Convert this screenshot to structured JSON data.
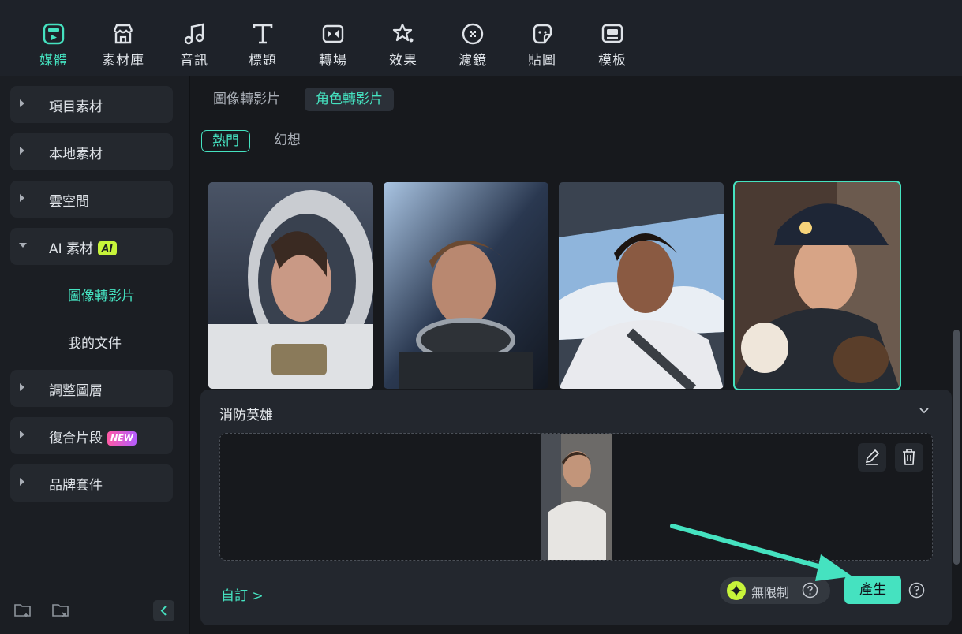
{
  "toolbar": {
    "items": [
      {
        "label": "媒體",
        "icon": "media-icon",
        "active": true
      },
      {
        "label": "素材庫",
        "icon": "store-icon"
      },
      {
        "label": "音訊",
        "icon": "music-note-icon"
      },
      {
        "label": "標題",
        "icon": "title-text-icon"
      },
      {
        "label": "轉場",
        "icon": "transition-icon"
      },
      {
        "label": "效果",
        "icon": "effects-star-icon"
      },
      {
        "label": "濾鏡",
        "icon": "filter-icon"
      },
      {
        "label": "貼圖",
        "icon": "sticker-icon"
      },
      {
        "label": "模板",
        "icon": "template-icon"
      }
    ]
  },
  "sidebar": {
    "items": [
      {
        "label": "項目素材"
      },
      {
        "label": "本地素材"
      },
      {
        "label": "雲空間"
      },
      {
        "label": "AI 素材",
        "badge": "AI",
        "expanded": true
      },
      {
        "label": "調整圖層"
      },
      {
        "label": "復合片段",
        "badge": "NEW"
      },
      {
        "label": "品牌套件"
      }
    ],
    "subitems": [
      {
        "label": "圖像轉影片",
        "active": true
      },
      {
        "label": "我的文件"
      }
    ]
  },
  "main": {
    "tabs": [
      {
        "label": "圖像轉影片"
      },
      {
        "label": "角色轉影片",
        "active": true
      }
    ],
    "filters": [
      {
        "label": "熱門",
        "active": true
      },
      {
        "label": "幻想"
      }
    ],
    "cards": [
      {
        "name": "astronaut-woman"
      },
      {
        "name": "astronaut-man"
      },
      {
        "name": "pilot"
      },
      {
        "name": "firefighter",
        "selected": true
      }
    ]
  },
  "panel": {
    "title": "消防英雄",
    "custom_link": "自訂 >",
    "unlimited": "無限制",
    "generate": "產生"
  },
  "colors": {
    "accent": "#45e2c0",
    "ai_badge": "#c7f43a",
    "background": "#17191d"
  }
}
